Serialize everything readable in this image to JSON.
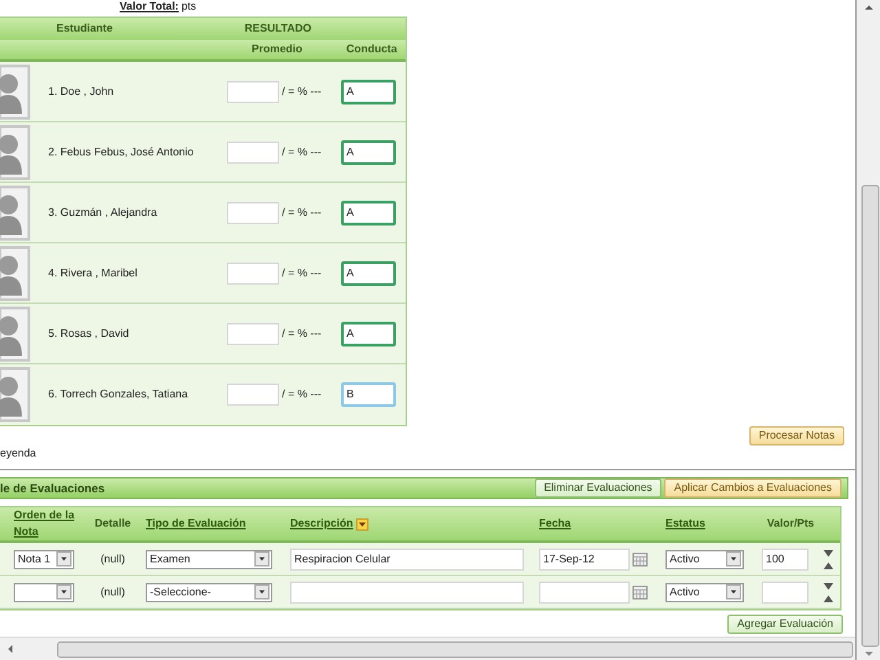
{
  "valor_total": {
    "label": "Valor Total:",
    "value": "pts"
  },
  "students_table": {
    "header": {
      "student": "Estudiante",
      "result": "RESULTADO",
      "promedio": "Promedio",
      "conducta": "Conducta"
    },
    "rows": [
      {
        "name": "1. Doe , John",
        "promedio": "",
        "suffix": "/ = % ---",
        "conducta": "A",
        "focused": false
      },
      {
        "name": "2. Febus Febus, José Antonio",
        "promedio": "",
        "suffix": "/ = % ---",
        "conducta": "A",
        "focused": false
      },
      {
        "name": "3. Guzmán , Alejandra",
        "promedio": "",
        "suffix": "/ = % ---",
        "conducta": "A",
        "focused": false
      },
      {
        "name": "4. Rivera , Maribel",
        "promedio": "",
        "suffix": "/ = % ---",
        "conducta": "A",
        "focused": false
      },
      {
        "name": "5. Rosas , David",
        "promedio": "",
        "suffix": "/ = % ---",
        "conducta": "A",
        "focused": false
      },
      {
        "name": "6. Torrech Gonzales, Tatiana",
        "promedio": "",
        "suffix": "/ = % ---",
        "conducta": "B",
        "focused": true
      }
    ]
  },
  "legend": "eyenda",
  "process_button": "Procesar Notas",
  "evaluations": {
    "title": "le de Evaluaciones",
    "buttons": [
      {
        "label": "Eliminar Evaluaciones",
        "kind": "green"
      },
      {
        "label": "Aplicar Cambios a Evaluaciones",
        "kind": "orange"
      }
    ],
    "columns": [
      {
        "label": "Orden de la Nota",
        "kind": "link"
      },
      {
        "label": "Detalle",
        "kind": "plain"
      },
      {
        "label": "Tipo de Evaluación",
        "kind": "link"
      },
      {
        "label": "Descripción",
        "kind": "sort"
      },
      {
        "label": "Fecha",
        "kind": "link"
      },
      {
        "label": "Estatus",
        "kind": "link"
      },
      {
        "label": "Valor/Pts",
        "kind": "plain"
      }
    ],
    "rows": [
      {
        "orden": "Nota 1",
        "detalle": "(null)",
        "tipo": "Examen",
        "descripcion": "Respiracion Celular",
        "fecha": "17-Sep-12",
        "estatus": "Activo",
        "valor": "100"
      },
      {
        "orden": "",
        "detalle": "(null)",
        "tipo": "-Seleccione-",
        "descripcion": "",
        "fecha": "",
        "estatus": "Activo",
        "valor": ""
      }
    ],
    "add_button": "Agregar Evaluación"
  }
}
